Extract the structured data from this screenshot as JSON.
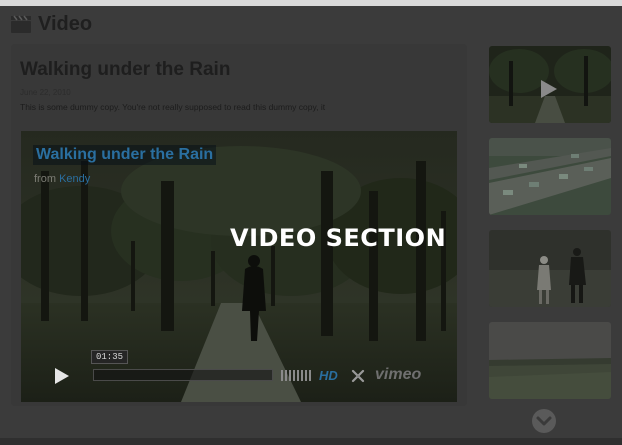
{
  "header": {
    "title": "Video",
    "icon": "clapperboard-icon"
  },
  "post": {
    "title": "Walking under the Rain",
    "date": "June 22, 2010",
    "excerpt": "This is some dummy copy. You're not really supposed to read this dummy copy, it"
  },
  "player": {
    "video_title": "Walking under the Rain",
    "from_label": "from",
    "author": "Kendy",
    "overlay": "VIDEO SECTION",
    "time": "01:35",
    "progress": 0.0,
    "hd_label": "HD",
    "brand": "vimeo",
    "accent": "#2a6fa0"
  },
  "thumbnails": [
    "thumbnail-park-walker",
    "thumbnail-highway-traffic",
    "thumbnail-people-walking",
    "thumbnail-field-landscape"
  ]
}
